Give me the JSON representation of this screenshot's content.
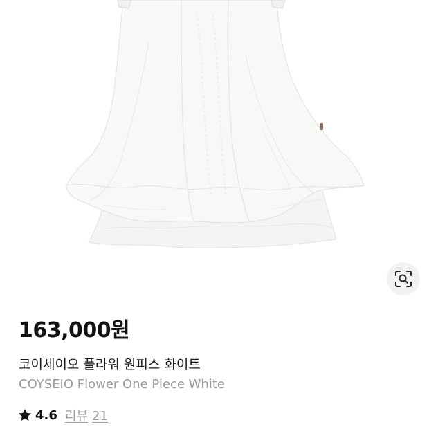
{
  "product": {
    "price": "163,000원",
    "name_ko": "코이세이오 플라워 원피스 화이트",
    "name_en": "COYSEIO Flower One Piece White",
    "rating": "4.6",
    "review_label": "리뷰",
    "review_count": "21"
  },
  "icons": {
    "lens": "visual-search-icon",
    "star": "star-icon"
  },
  "colors": {
    "text_primary": "#111111",
    "text_secondary": "#9a9a9a",
    "lens_button_bg": "#f2f2f3"
  }
}
